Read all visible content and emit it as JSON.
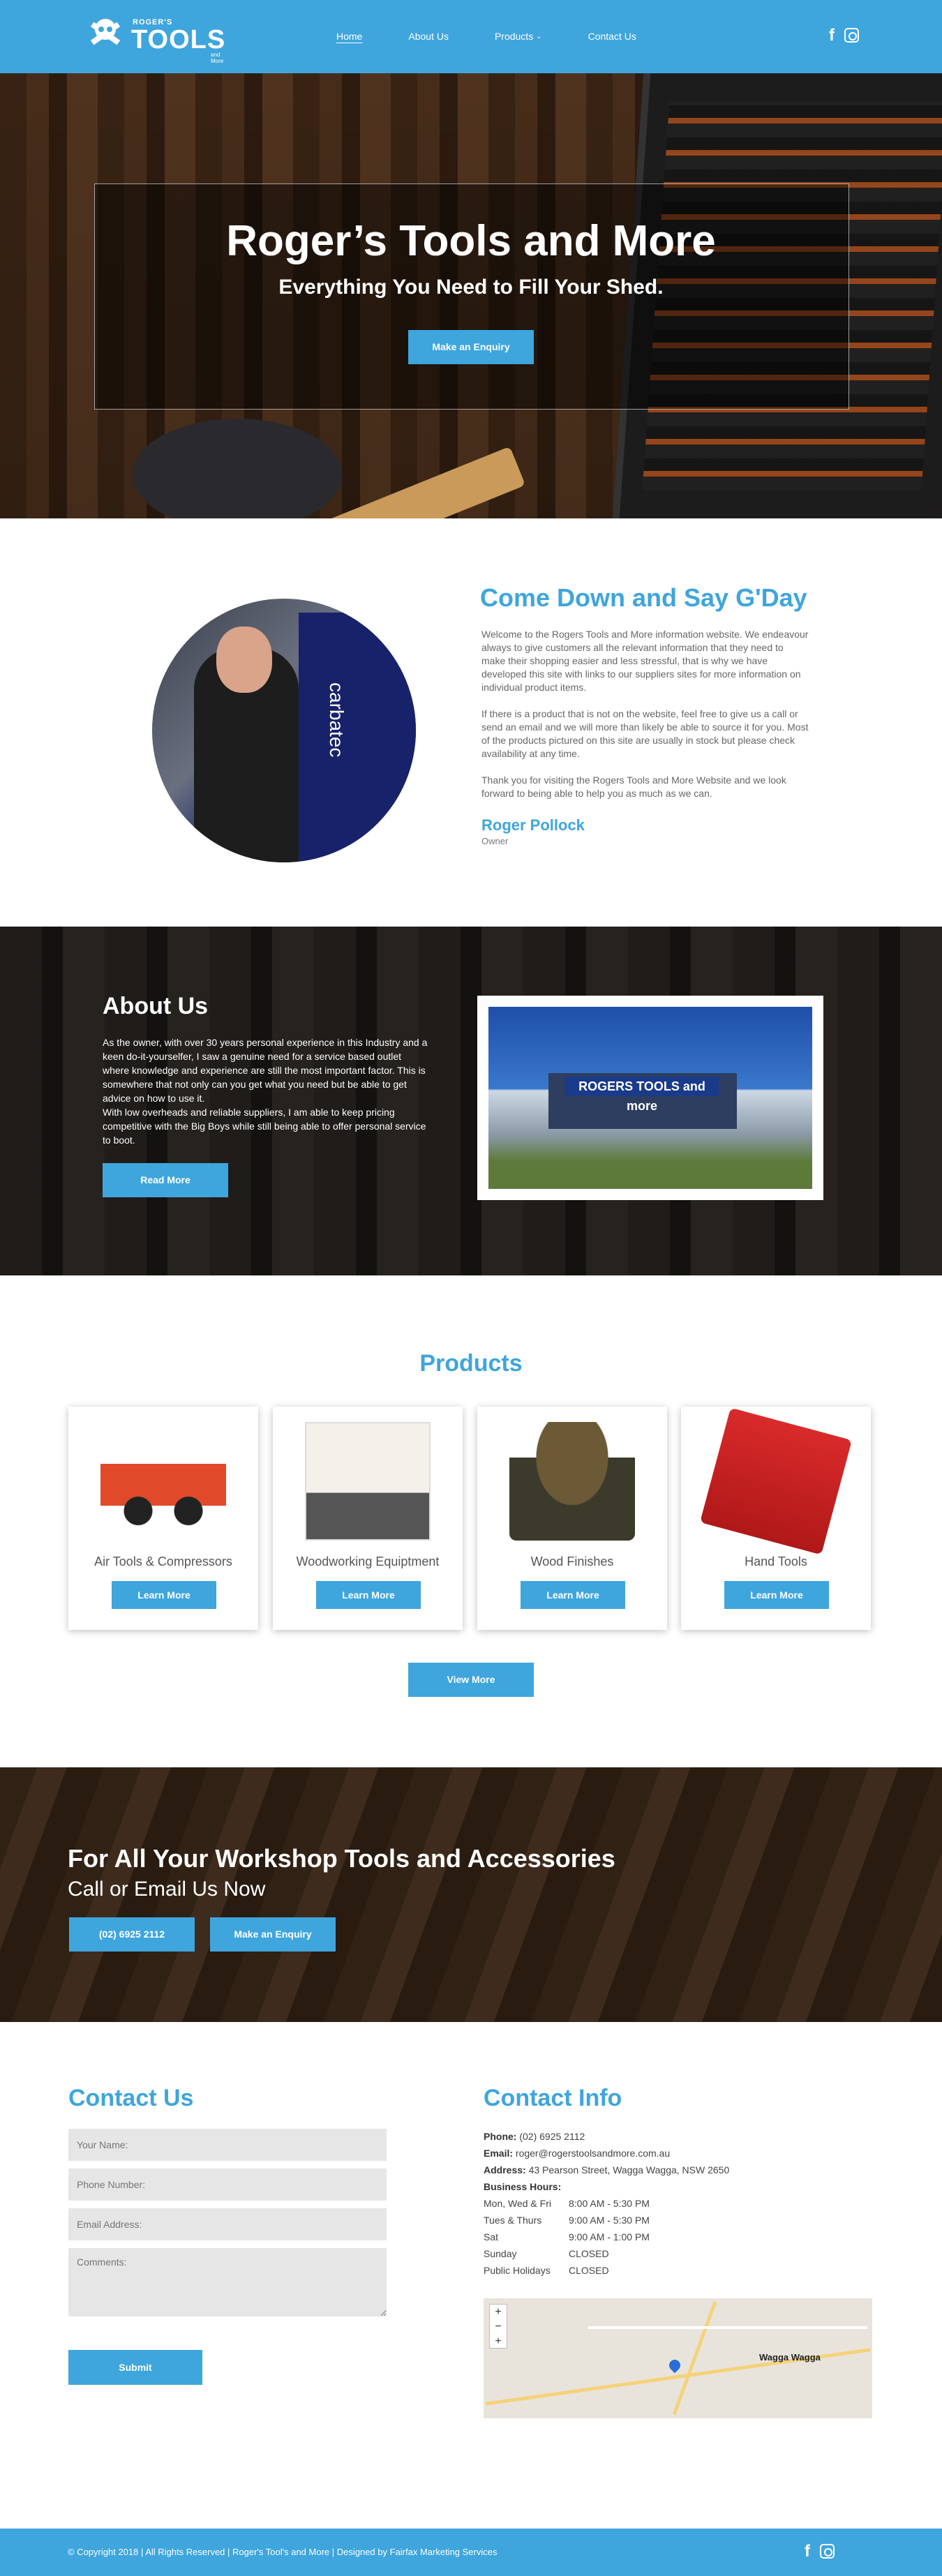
{
  "header": {
    "logo_small": "ROGER'S",
    "logo_big": "TOOLS",
    "logo_sub": "and More",
    "nav": [
      "Home",
      "About Us",
      "Products",
      "Contact Us"
    ],
    "icons": [
      "facebook-icon",
      "instagram-icon"
    ]
  },
  "hero": {
    "title": "Roger’s Tools and More",
    "subtitle": "Everything You Need to Fill Your Shed.",
    "button": "Make an Enquiry"
  },
  "welcome": {
    "title": "Come Down and Say G'Day",
    "p1": "Welcome to the Rogers Tools and More information website. We endeavour always to give customers all the relevant information that they need to make their shopping easier and less stressful, that is why we have developed this site with links to our suppliers sites for more information on individual product items.",
    "p2": "If there is a product that is not on the website, feel free to give us a call or send an email and we will more than likely be able to source it for you. Most of the products pictured on this site are usually in stock but please check availability at any time.",
    "p3": "Thank you for visiting the Rogers Tools and More Website and we look forward to being able to help you as much as we can.",
    "name": "Roger Pollock",
    "role": "Owner",
    "photo_text": "carbatec"
  },
  "about": {
    "title": "About Us",
    "p1": "As the owner, with over 30 years personal experience in this Industry and a keen do-it-yourselfer, I saw a genuine need for a service based outlet where knowledge and experience are still the most important factor. This is somewhere that not only can you get what you need but be able to get advice on how to use it.",
    "p2": "With low overheads and reliable suppliers, I am able to keep pricing competitive with the Big Boys while still being able to offer personal service to boot.",
    "button": "Read More",
    "shop_sign": "ROGERS TOOLS and more"
  },
  "products": {
    "title": "Products",
    "items": [
      {
        "name": "Air Tools & Compressors",
        "button": "Learn More"
      },
      {
        "name": "Woodworking Equiptment",
        "button": "Learn More"
      },
      {
        "name": "Wood Finishes",
        "button": "Learn More"
      },
      {
        "name": "Hand Tools",
        "button": "Learn More"
      }
    ],
    "view_more": "View More"
  },
  "cta": {
    "title": "For All Your Workshop Tools and Accessories",
    "subtitle": "Call or Email Us Now",
    "phone_button": "(02) 6925 2112",
    "enquiry_button": "Make an Enquiry"
  },
  "contact_form": {
    "title": "Contact Us",
    "name_placeholder": "Your Name:",
    "phone_placeholder": "Phone Number:",
    "email_placeholder": "Email Address:",
    "comments_placeholder": "Comments:",
    "submit": "Submit"
  },
  "contact_info": {
    "title": "Contact Info",
    "phone_label": "Phone:",
    "phone": "(02) 6925 2112",
    "email_label": "Email:",
    "email": "roger@rogerstoolsandmore.com.au",
    "address_label": "Address:",
    "address": "43 Pearson Street, Wagga Wagga, NSW 2650",
    "hours_label": "Business Hours:",
    "hours": [
      {
        "day": "Mon, Wed & Fri",
        "time": "8:00 AM - 5:30 PM"
      },
      {
        "day": "Tues & Thurs",
        "time": "9:00 AM - 5:30 PM"
      },
      {
        "day": "Sat",
        "time": "9:00 AM - 1:00 PM"
      },
      {
        "day": "Sunday",
        "time": "CLOSED"
      },
      {
        "day": "Public Holidays",
        "time": "CLOSED"
      }
    ],
    "map_label": "Wagga Wagga"
  },
  "footer": {
    "copyright": "© Copyright 2018 | All Rights Reserved | Roger's Tool's and More | Designed by Fairfax Marketing Services"
  },
  "colors": {
    "accent": "#3fa5dd",
    "footer": "#3fa5dd"
  }
}
